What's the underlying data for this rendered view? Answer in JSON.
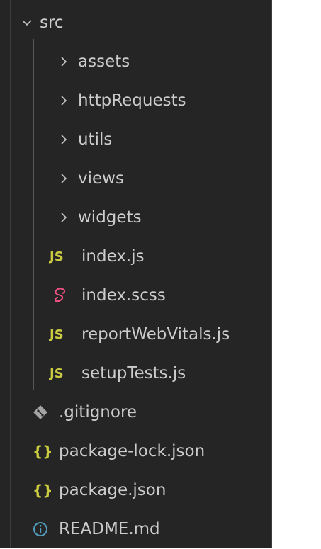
{
  "explorer": {
    "colors": {
      "background": "#252526",
      "text": "#cccccc",
      "js": "#cbcb41",
      "json": "#cbcb41",
      "sass": "#f55385",
      "git": "#a4a4a4",
      "info": "#519aba"
    },
    "src_folder": {
      "label": "src",
      "icon": "chevron-down-icon",
      "expanded": true
    },
    "subfolders": [
      {
        "label": "assets",
        "icon": "chevron-right-icon"
      },
      {
        "label": "httpRequests",
        "icon": "chevron-right-icon"
      },
      {
        "label": "utils",
        "icon": "chevron-right-icon"
      },
      {
        "label": "views",
        "icon": "chevron-right-icon"
      },
      {
        "label": "widgets",
        "icon": "chevron-right-icon"
      }
    ],
    "src_files": [
      {
        "label": "index.js",
        "icon": "js-icon",
        "icon_text": "JS"
      },
      {
        "label": "index.scss",
        "icon": "sass-icon"
      },
      {
        "label": "reportWebVitals.js",
        "icon": "js-icon",
        "icon_text": "JS"
      },
      {
        "label": "setupTests.js",
        "icon": "js-icon",
        "icon_text": "JS"
      }
    ],
    "root_files": [
      {
        "label": ".gitignore",
        "icon": "git-icon"
      },
      {
        "label": "package-lock.json",
        "icon": "json-icon",
        "icon_text": "{}"
      },
      {
        "label": "package.json",
        "icon": "json-icon",
        "icon_text": "{}"
      },
      {
        "label": "README.md",
        "icon": "info-icon"
      }
    ]
  }
}
